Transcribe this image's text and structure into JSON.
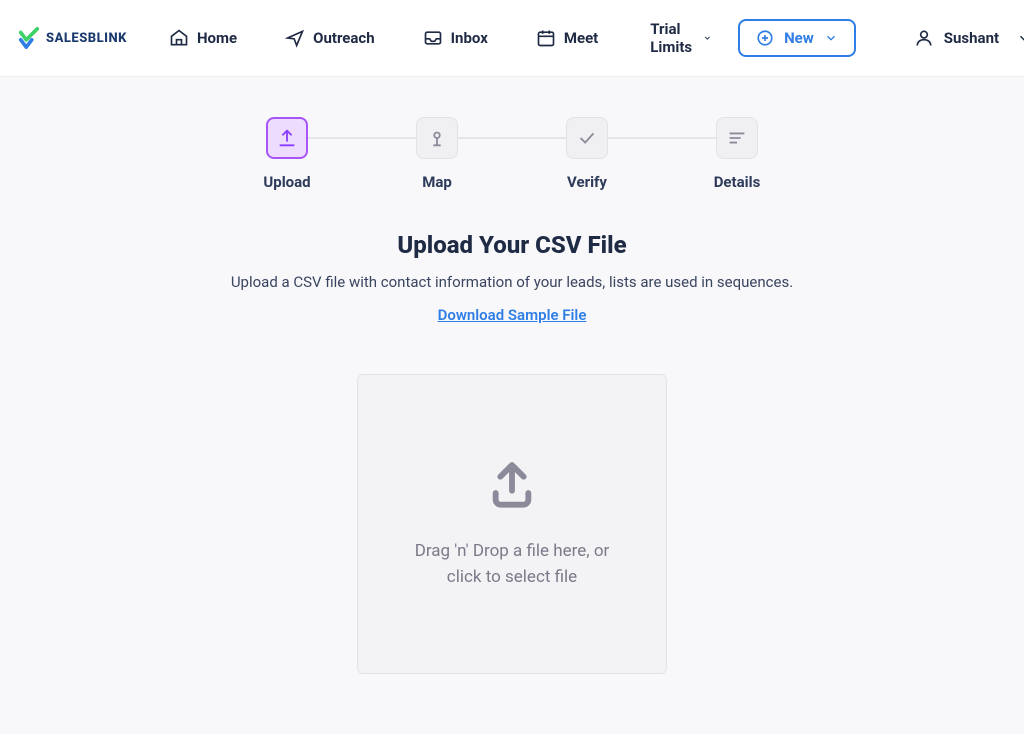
{
  "brand": {
    "name": "SALESBLINK"
  },
  "nav": {
    "home": "Home",
    "outreach": "Outreach",
    "inbox": "Inbox",
    "meet": "Meet"
  },
  "header": {
    "trial_limits": "Trial Limits",
    "new_button": "New",
    "username": "Sushant"
  },
  "stepper": {
    "upload": "Upload",
    "map": "Map",
    "verify": "Verify",
    "details": "Details"
  },
  "content": {
    "title": "Upload Your CSV File",
    "description": "Upload a CSV file with contact information of your leads, lists are used in sequences.",
    "download_link": "Download Sample File"
  },
  "dropzone": {
    "text": "Drag 'n' Drop a file here, or click to select file"
  }
}
